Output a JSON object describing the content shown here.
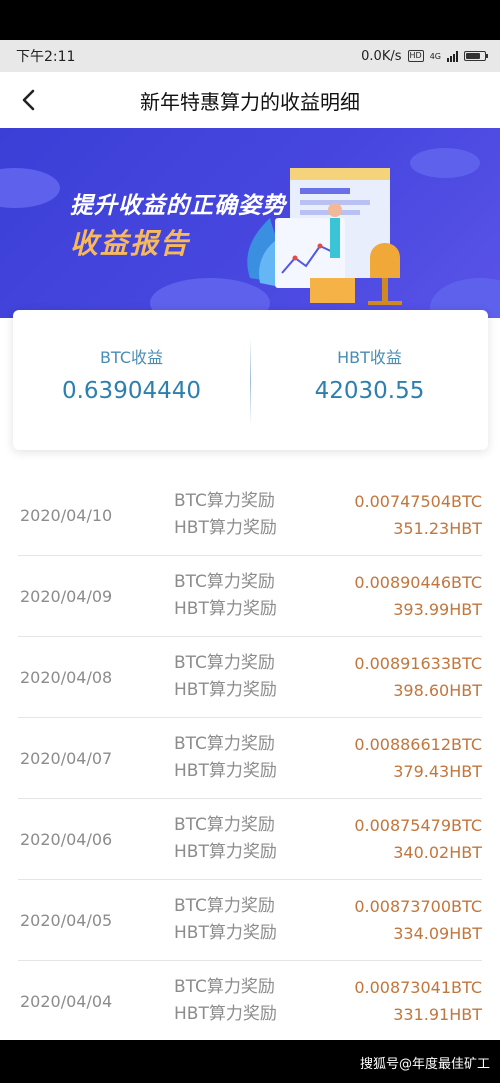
{
  "status_bar": {
    "time": "下午2:11",
    "speed": "0.0K/s",
    "hd_badge": "HD",
    "network_badge": "4G"
  },
  "nav": {
    "title": "新年特惠算力的收益明细"
  },
  "banner": {
    "line1": "提升收益的正确姿势",
    "line2": "收益报告"
  },
  "summary": {
    "btc_label": "BTC收益",
    "btc_value": "0.63904440",
    "hbt_label": "HBT收益",
    "hbt_value": "42030.55"
  },
  "records": [
    {
      "date": "2020/04/10",
      "btc_label": "BTC算力奖励",
      "hbt_label": "HBT算力奖励",
      "btc_amount": "0.00747504BTC",
      "hbt_amount": "351.23HBT"
    },
    {
      "date": "2020/04/09",
      "btc_label": "BTC算力奖励",
      "hbt_label": "HBT算力奖励",
      "btc_amount": "0.00890446BTC",
      "hbt_amount": "393.99HBT"
    },
    {
      "date": "2020/04/08",
      "btc_label": "BTC算力奖励",
      "hbt_label": "HBT算力奖励",
      "btc_amount": "0.00891633BTC",
      "hbt_amount": "398.60HBT"
    },
    {
      "date": "2020/04/07",
      "btc_label": "BTC算力奖励",
      "hbt_label": "HBT算力奖励",
      "btc_amount": "0.00886612BTC",
      "hbt_amount": "379.43HBT"
    },
    {
      "date": "2020/04/06",
      "btc_label": "BTC算力奖励",
      "hbt_label": "HBT算力奖励",
      "btc_amount": "0.00875479BTC",
      "hbt_amount": "340.02HBT"
    },
    {
      "date": "2020/04/05",
      "btc_label": "BTC算力奖励",
      "hbt_label": "HBT算力奖励",
      "btc_amount": "0.00873700BTC",
      "hbt_amount": "334.09HBT"
    },
    {
      "date": "2020/04/04",
      "btc_label": "BTC算力奖励",
      "hbt_label": "HBT算力奖励",
      "btc_amount": "0.00873041BTC",
      "hbt_amount": "331.91HBT"
    }
  ],
  "watermark": "搜狐号@年度最佳矿工",
  "colors": {
    "banner": "#4444dc",
    "accent_gold": "#f7b95a",
    "value_blue": "#2d7fae",
    "amount_orange": "#c2763d"
  }
}
